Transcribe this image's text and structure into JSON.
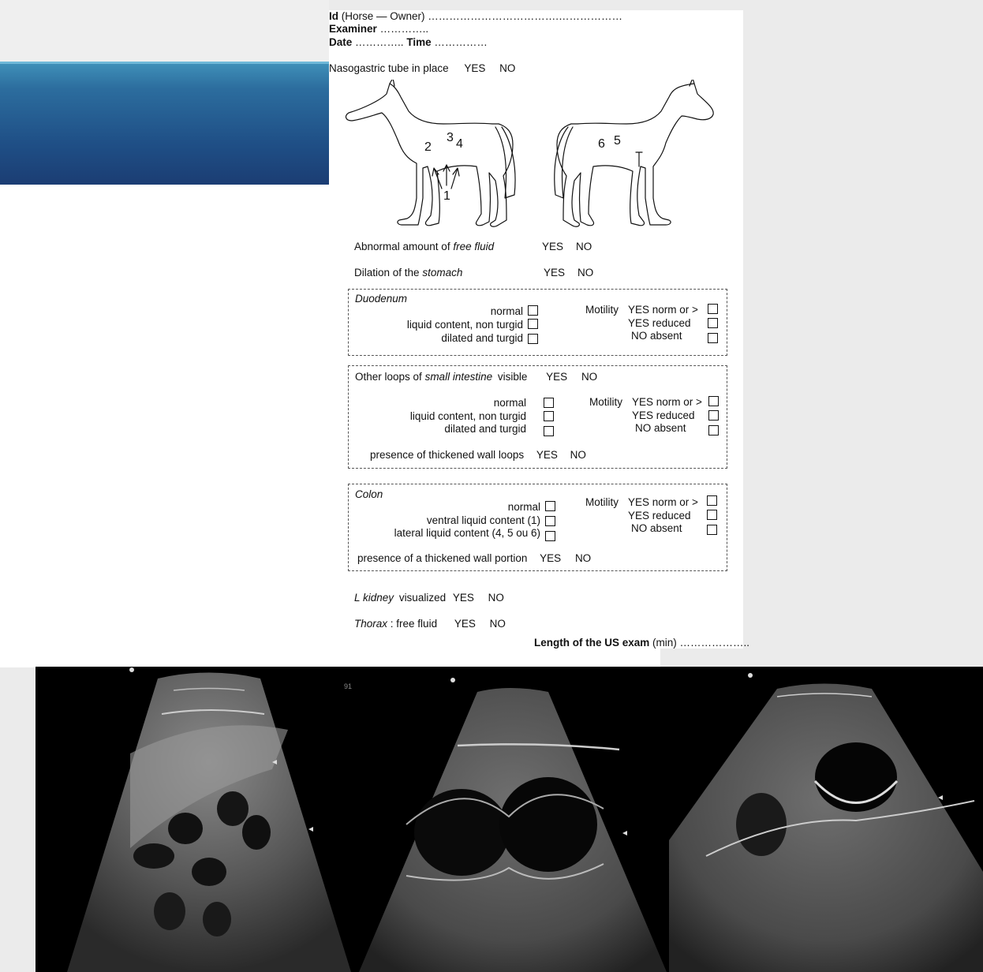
{
  "header": {
    "id_label": "Id",
    "id_rest": "(Horse — Owner) ……………………………….………………",
    "examiner_label": "Examiner",
    "examiner_dots": "…………..",
    "date_label": "Date",
    "date_dots": "…………..",
    "time_label": "Time",
    "time_dots": "……………"
  },
  "nasogastric": {
    "label": "Nasogastric tube in place",
    "yes": "YES",
    "no": "NO"
  },
  "diagram": {
    "labels_left": [
      "2",
      "3",
      "4",
      "1"
    ],
    "labels_right": [
      "6",
      "5"
    ]
  },
  "free_fluid": {
    "label_pre": "Abnormal amount of ",
    "label_em": "free fluid",
    "yes": "YES",
    "no": "NO"
  },
  "stomach": {
    "label_pre": "Dilation of the ",
    "label_em": "stomach",
    "yes": "YES",
    "no": "NO"
  },
  "duodenum": {
    "title": "Duodenum",
    "options": [
      "normal",
      "liquid content, non turgid",
      "dilated and turgid"
    ],
    "motility_label": "Motility",
    "motility": [
      "YES norm or >",
      "YES reduced",
      "NO absent"
    ]
  },
  "small_intestine": {
    "title_pre": "Other loops of ",
    "title_em": "small intestine",
    "title_post": "visible",
    "yes": "YES",
    "no": "NO",
    "options": [
      "normal",
      "liquid content, non turgid",
      "dilated and turgid"
    ],
    "motility_label": "Motility",
    "motility": [
      "YES norm or >",
      "YES reduced",
      "NO absent"
    ],
    "thickened_label": "presence of thickened wall loops",
    "thickened_yes": "YES",
    "thickened_no": "NO"
  },
  "colon": {
    "title": "Colon",
    "options": [
      "normal",
      "ventral liquid content (1)",
      "lateral liquid content (4, 5 ou 6)"
    ],
    "motility_label": "Motility",
    "motility": [
      "YES norm or >",
      "YES reduced",
      "NO absent"
    ],
    "thickened_label": "presence of a thickened wall portion",
    "thickened_yes": "YES",
    "thickened_no": "NO"
  },
  "kidney": {
    "label_em": "L kidney",
    "label_post": "visualized",
    "yes": "YES",
    "no": "NO"
  },
  "thorax": {
    "label_em": "Thorax",
    "label_post": ": free fluid",
    "yes": "YES",
    "no": "NO"
  },
  "exam_length": {
    "label": "Length of the US exam",
    "unit": "(min)",
    "dots": "……………….."
  },
  "ultrasound": {
    "count": 3,
    "markers": [
      "91"
    ]
  }
}
